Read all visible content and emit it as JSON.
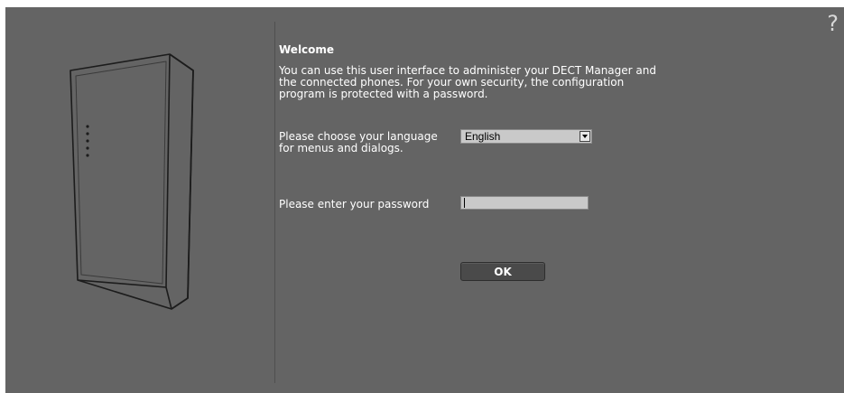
{
  "help": {
    "icon": "help-icon",
    "symbol": "?"
  },
  "welcome": {
    "title": "Welcome",
    "text": "You can use this user interface to administer your DECT Manager and the connected phones. For your own security, the configuration program is protected with a password."
  },
  "language": {
    "label": "Please choose your language for menus and dialogs.",
    "selected": "English"
  },
  "password": {
    "label": "Please enter your password",
    "value": ""
  },
  "ok_button": {
    "label": "OK"
  },
  "colors": {
    "background": "#646464",
    "text": "#ffffff",
    "input_background": "#c9c9c9",
    "button_background": "#4a4a4a"
  }
}
